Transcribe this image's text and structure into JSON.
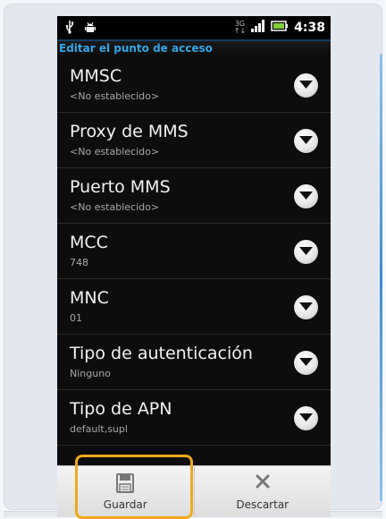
{
  "status_bar": {
    "network": "3G",
    "time": "4:38",
    "icons": [
      "usb-icon",
      "android-icon",
      "network-3g-icon",
      "signal-icon",
      "battery-icon"
    ]
  },
  "title": "Editar el punto de acceso",
  "accent_color": "#32a5e8",
  "highlight_color": "#f0a81c",
  "rows": [
    {
      "title": "MMSC",
      "value": "<No establecido>"
    },
    {
      "title": "Proxy de MMS",
      "value": "<No establecido>"
    },
    {
      "title": "Puerto MMS",
      "value": "<No establecido>"
    },
    {
      "title": "MCC",
      "value": "748"
    },
    {
      "title": "MNC",
      "value": "01"
    },
    {
      "title": "Tipo de autenticación",
      "value": "Ninguno"
    },
    {
      "title": "Tipo de APN",
      "value": "default,supl"
    }
  ],
  "actions": {
    "save": {
      "label": "Guardar",
      "icon": "save-icon"
    },
    "discard": {
      "label": "Descartar",
      "icon": "close-icon"
    }
  }
}
